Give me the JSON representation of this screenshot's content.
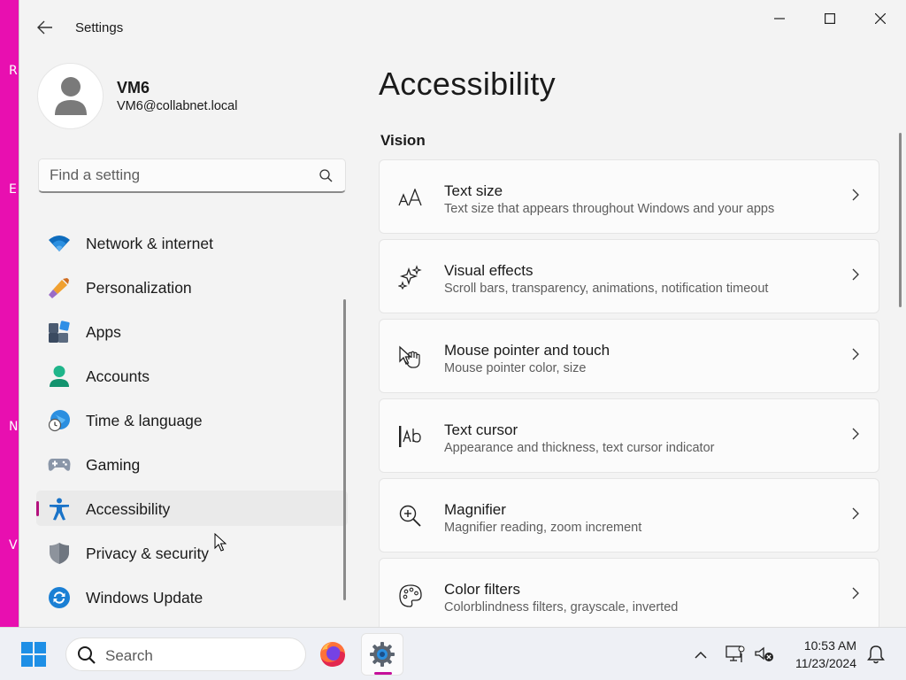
{
  "window": {
    "app_title": "Settings"
  },
  "profile": {
    "name": "VM6",
    "email": "VM6@collabnet.local"
  },
  "search": {
    "placeholder": "Find a setting"
  },
  "sidebar": {
    "items": [
      {
        "label": "Network & internet",
        "icon": "wifi-icon"
      },
      {
        "label": "Personalization",
        "icon": "brush-icon"
      },
      {
        "label": "Apps",
        "icon": "apps-icon"
      },
      {
        "label": "Accounts",
        "icon": "person-icon"
      },
      {
        "label": "Time & language",
        "icon": "globe-clock-icon"
      },
      {
        "label": "Gaming",
        "icon": "gamepad-icon"
      },
      {
        "label": "Accessibility",
        "icon": "accessibility-icon",
        "selected": true
      },
      {
        "label": "Privacy & security",
        "icon": "shield-icon"
      },
      {
        "label": "Windows Update",
        "icon": "update-icon"
      }
    ]
  },
  "main": {
    "title": "Accessibility",
    "section": "Vision",
    "cards": [
      {
        "title": "Text size",
        "description": "Text size that appears throughout Windows and your apps",
        "icon": "text-size-icon"
      },
      {
        "title": "Visual effects",
        "description": "Scroll bars, transparency, animations, notification timeout",
        "icon": "sparkle-icon"
      },
      {
        "title": "Mouse pointer and touch",
        "description": "Mouse pointer color, size",
        "icon": "pointer-hand-icon"
      },
      {
        "title": "Text cursor",
        "description": "Appearance and thickness, text cursor indicator",
        "icon": "text-cursor-icon"
      },
      {
        "title": "Magnifier",
        "description": "Magnifier reading, zoom increment",
        "icon": "magnifier-icon"
      },
      {
        "title": "Color filters",
        "description": "Colorblindness filters, grayscale, inverted",
        "icon": "palette-icon"
      }
    ]
  },
  "taskbar": {
    "search_label": "Search",
    "time": "10:53 AM",
    "date": "11/23/2024"
  },
  "colors": {
    "accent": "#b3117d",
    "desktop": "#e80fb0"
  }
}
